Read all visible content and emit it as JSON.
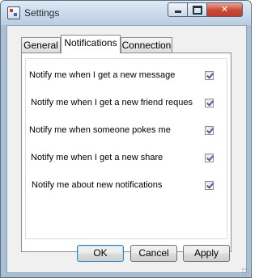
{
  "window": {
    "title": "Settings"
  },
  "tabs": [
    {
      "label": "General"
    },
    {
      "label": "Notifications"
    },
    {
      "label": "Connection"
    }
  ],
  "notifications": [
    {
      "label": "Notify me when I get a new message",
      "checked": true
    },
    {
      "label": "Notify me when I get a new friend reques",
      "checked": true
    },
    {
      "label": "Notify me when someone pokes me",
      "checked": true
    },
    {
      "label": "Notify me when I get a new share",
      "checked": true
    },
    {
      "label": "Notify me about new notifications",
      "checked": true
    }
  ],
  "buttons": {
    "ok": "OK",
    "cancel": "Cancel",
    "apply": "Apply"
  }
}
